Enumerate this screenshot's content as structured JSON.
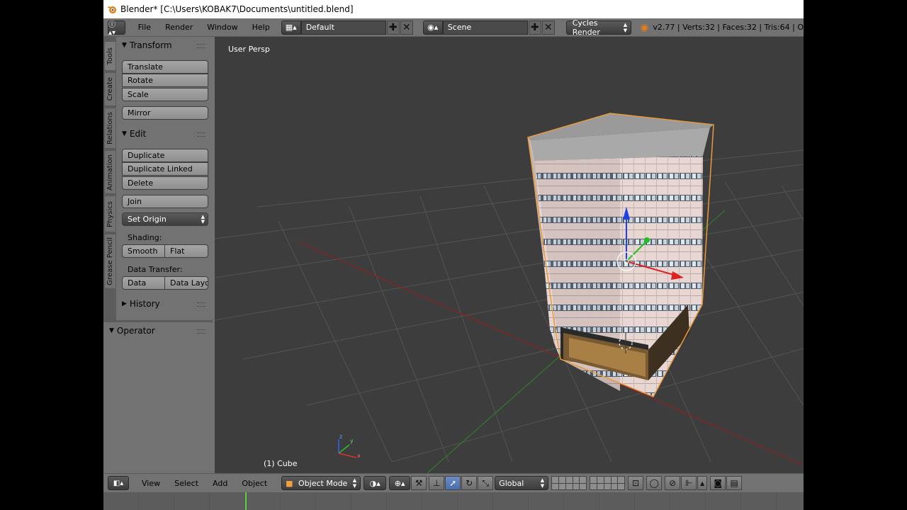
{
  "window": {
    "title": "Blender* [C:\\Users\\KOBAK7\\Documents\\untitled.blend]"
  },
  "header": {
    "menus": [
      "File",
      "Render",
      "Window",
      "Help"
    ],
    "layout": "Default",
    "scene": "Scene",
    "render_engine": "Cycles Render",
    "stats": "v2.77 | Verts:32 | Faces:32 | Tris:64 | O"
  },
  "tabs": [
    "Tools",
    "Create",
    "Relations",
    "Animation",
    "Physics",
    "Grease Pencil"
  ],
  "toolshelf": {
    "transform": {
      "title": "Transform",
      "buttons": [
        "Translate",
        "Rotate",
        "Scale"
      ],
      "mirror": "Mirror"
    },
    "edit": {
      "title": "Edit",
      "buttons": [
        "Duplicate",
        "Duplicate Linked",
        "Delete"
      ],
      "join": "Join",
      "set_origin": "Set Origin",
      "shading_label": "Shading:",
      "smooth": "Smooth",
      "flat": "Flat",
      "data_transfer_label": "Data Transfer:",
      "data": "Data",
      "data_layout": "Data Layo"
    },
    "history": {
      "title": "History"
    }
  },
  "operator": {
    "title": "Operator"
  },
  "viewport": {
    "view_name": "User Persp",
    "object_info": "(1) Cube",
    "axis_x": "x",
    "axis_y": "y",
    "axis_z": "z"
  },
  "bottombar": {
    "menus": [
      "View",
      "Select",
      "Add",
      "Object"
    ],
    "mode": "Object Mode",
    "orientation": "Global"
  },
  "colors": {
    "selection": "#e89a3c",
    "x_axis": "#e02020",
    "y_axis": "#20c020",
    "z_axis": "#2040e0",
    "grid": "#545454"
  }
}
